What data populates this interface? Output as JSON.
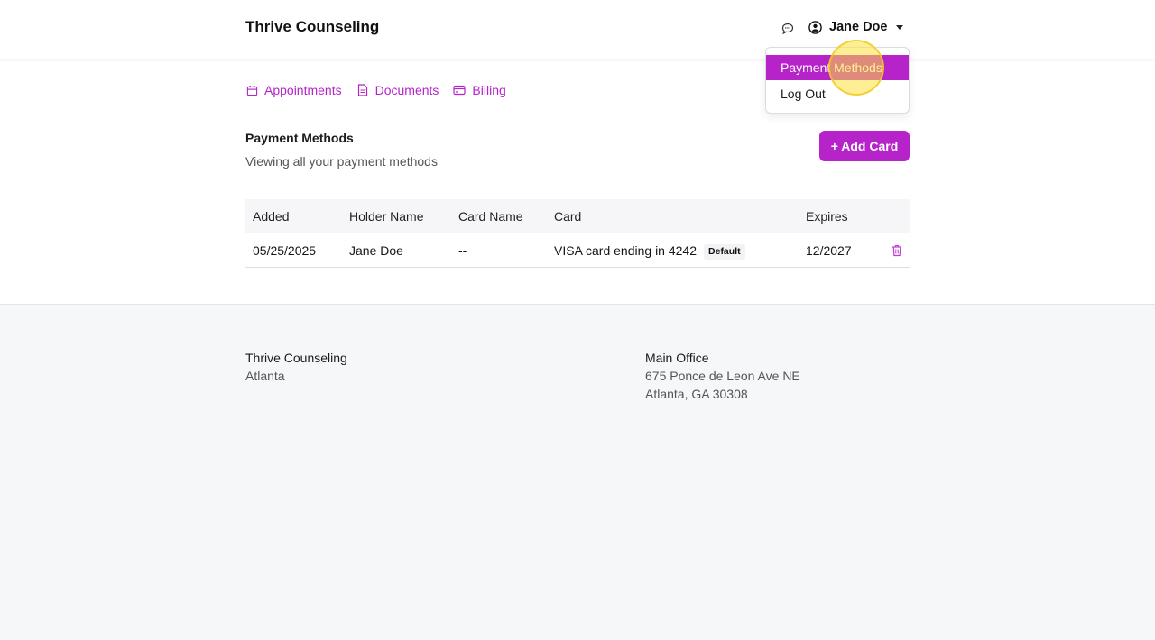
{
  "header": {
    "brand": "Thrive Counseling",
    "user_name": "Jane Doe"
  },
  "user_menu": {
    "items": [
      {
        "label": "Payment Methods",
        "active": true
      },
      {
        "label": "Log Out",
        "active": false
      }
    ]
  },
  "nav": {
    "tabs": [
      {
        "label": "Appointments",
        "icon": "calendar-icon"
      },
      {
        "label": "Documents",
        "icon": "document-icon"
      },
      {
        "label": "Billing",
        "icon": "credit-card-icon"
      }
    ]
  },
  "payment_methods": {
    "title": "Payment Methods",
    "subtitle": "Viewing all your payment methods",
    "add_button": "+ Add Card",
    "columns": [
      "Added",
      "Holder Name",
      "Card Name",
      "Card",
      "Expires"
    ],
    "rows": [
      {
        "added": "05/25/2025",
        "holder_name": "Jane Doe",
        "card_name": "--",
        "card": "VISA card ending in 4242",
        "badge": "Default",
        "expires": "12/2027"
      }
    ]
  },
  "footer": {
    "left": {
      "title": "Thrive Counseling",
      "line1": "Atlanta"
    },
    "right": {
      "title": "Main Office",
      "line1": "675 Ponce de Leon Ave NE",
      "line2": "Atlanta, GA 30308"
    }
  },
  "colors": {
    "accent": "#b523c9",
    "footer_bg": "#f6f7f9",
    "table_header_bg": "#f6f6f8"
  }
}
